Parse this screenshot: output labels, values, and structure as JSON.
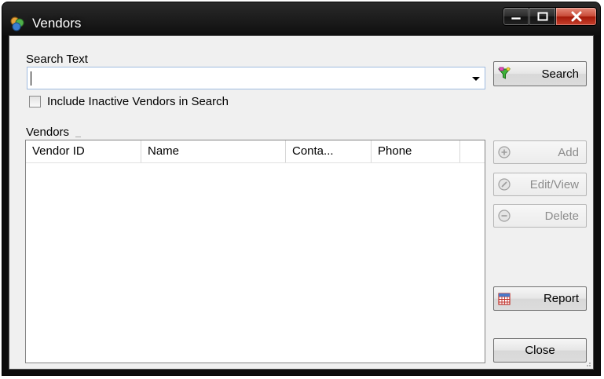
{
  "window": {
    "title": "Vendors",
    "icons": {
      "app": "vendors-app-icon",
      "minimize": "minimize-icon",
      "maximize": "maximize-icon",
      "close": "close-x-icon"
    }
  },
  "search": {
    "label": "Search Text",
    "value": "",
    "placeholder": "",
    "button_label": "Search",
    "button_icon": "funnel-filter-icon"
  },
  "filters": {
    "include_inactive_label": "Include Inactive Vendors in Search",
    "include_inactive_checked": false
  },
  "vendors_group": {
    "label": "Vendors",
    "columns": [
      "Vendor ID",
      "Name",
      "Conta...",
      "Phone"
    ],
    "rows": []
  },
  "actions": {
    "add_label": "Add",
    "edit_view_label": "Edit/View",
    "delete_label": "Delete",
    "report_label": "Report",
    "close_label": "Close",
    "add_enabled": false,
    "edit_view_enabled": false,
    "delete_enabled": false
  },
  "colors": {
    "titlebar": "#1a1a1a",
    "client_bg": "#f0f0f0",
    "close_button_red": "#c74a36",
    "search_border_blue": "#9fbbe0"
  }
}
